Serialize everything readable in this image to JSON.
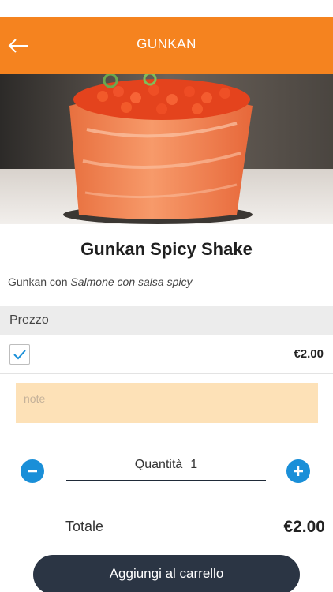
{
  "header": {
    "title": "GUNKAN",
    "back_icon": "arrow-left-icon",
    "background": "#f5831f"
  },
  "product": {
    "name": "Gunkan Spicy Shake",
    "desc_prefix": "Gunkan con",
    "desc_italic": "Salmone con salsa spicy"
  },
  "price_section": {
    "header_label": "Prezzo",
    "options": [
      {
        "checked": true,
        "price": "€2.00"
      }
    ]
  },
  "note": {
    "placeholder": "note",
    "value": ""
  },
  "quantity": {
    "label": "Quantità",
    "value": "1",
    "minus_icon": "minus-circle-icon",
    "plus_icon": "plus-circle-icon",
    "accent": "#1a8fd8"
  },
  "total": {
    "label": "Totale",
    "value": "€2.00"
  },
  "cart_button": {
    "label": "Aggiungi al carrello",
    "background": "#2b3544"
  }
}
